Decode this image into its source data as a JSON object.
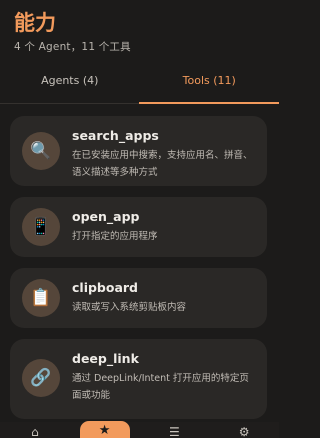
{
  "header": {
    "title": "能力",
    "subtitle": "4 个 Agent，11 个工具"
  },
  "tabs": [
    {
      "label": "Agents (4)",
      "active": false
    },
    {
      "label": "Tools (11)",
      "active": true
    }
  ],
  "tools": [
    {
      "name": "search_apps",
      "desc": "在已安装应用中搜索，支持应用名、拼音、语义描述等多种方式",
      "icon": "search-icon"
    },
    {
      "name": "open_app",
      "desc": "打开指定的应用程序",
      "icon": "phone-icon"
    },
    {
      "name": "clipboard",
      "desc": "读取或写入系统剪贴板内容",
      "icon": "clipboard-icon"
    },
    {
      "name": "deep_link",
      "desc": "通过 DeepLink/Intent 打开应用的特定页面或功能",
      "icon": "link-icon"
    }
  ],
  "bottom_nav": [
    {
      "icon": "home-icon"
    },
    {
      "icon": "star-icon",
      "active": true
    },
    {
      "icon": "list-icon"
    },
    {
      "icon": "settings-icon"
    }
  ],
  "colors": {
    "accent": "#f29a5c",
    "background": "#1c1b1a",
    "card": "#2a2826"
  }
}
